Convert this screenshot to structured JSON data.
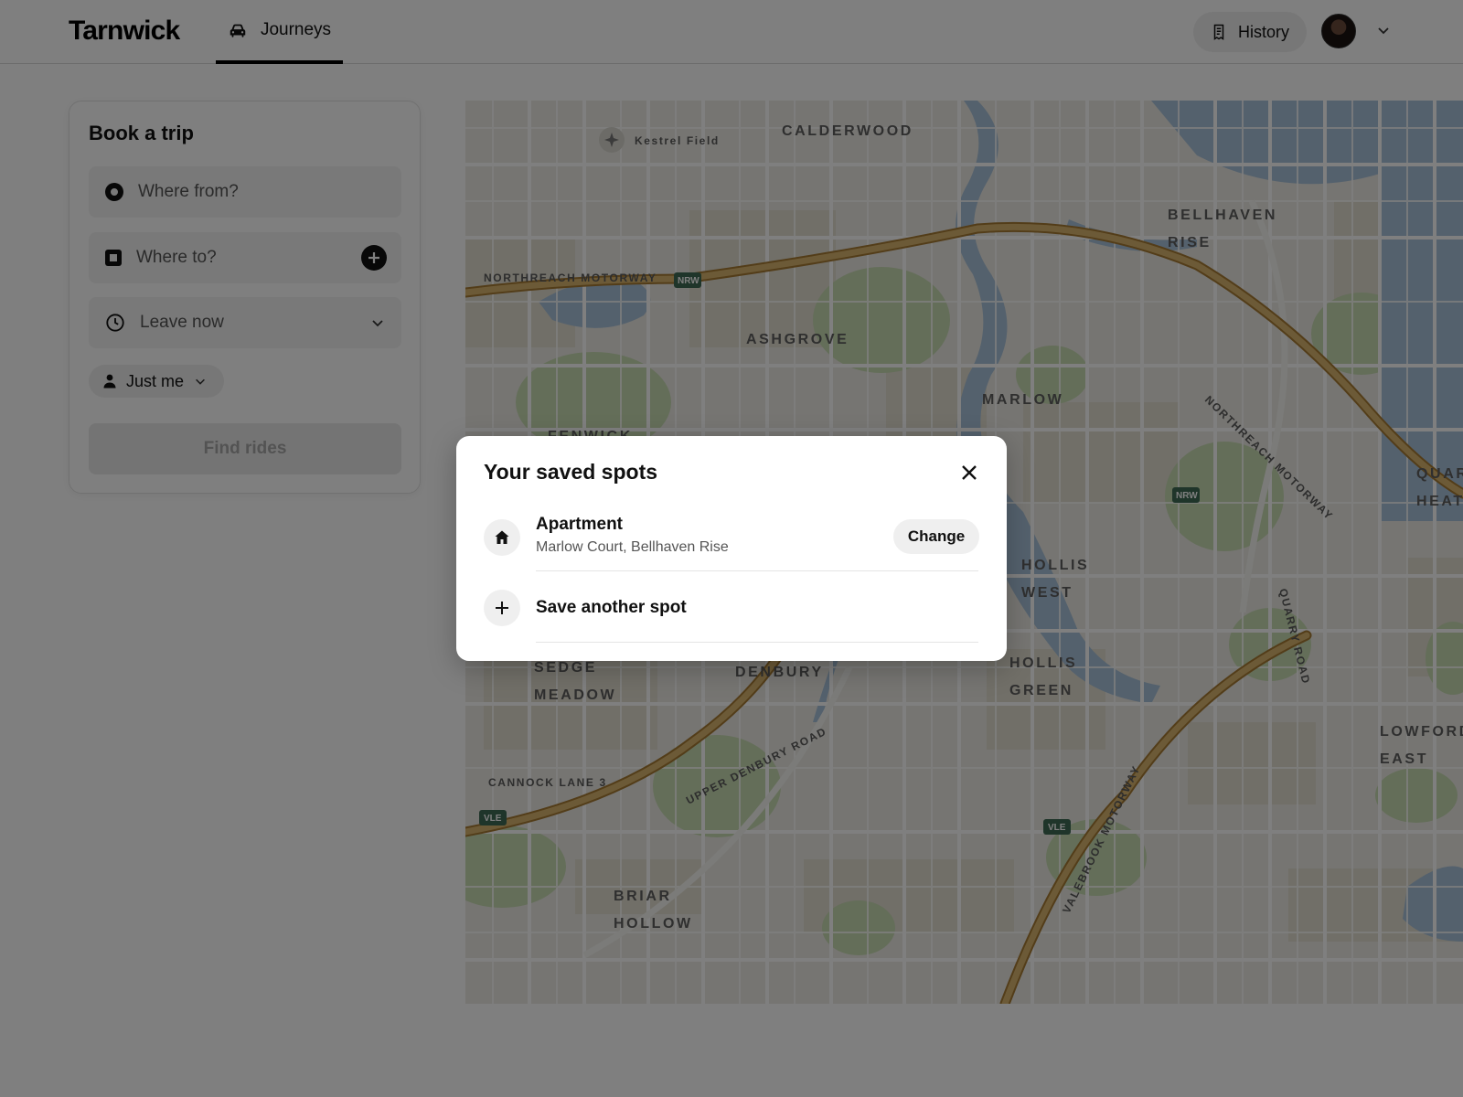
{
  "header": {
    "logo": "Tarnwick",
    "nav_tab": {
      "label": "Journeys",
      "icon": "car-icon"
    },
    "history": {
      "label": "History",
      "icon": "receipt-icon"
    },
    "avatar_menu_icon": "chevron-down-icon"
  },
  "booking": {
    "title": "Book a trip",
    "from_placeholder": "Where from?",
    "to_placeholder": "Where to?",
    "time_value": "Leave now",
    "riders_value": "Just me",
    "find_button": "Find rides"
  },
  "map": {
    "districts": [
      "CALDERWOOD",
      "BELLHAVEN",
      "RISE",
      "ASHGROVE",
      "MARLOW",
      "FENWICK",
      "QUAR",
      "HEAT",
      "HOLLIS",
      "WEST",
      "HOLLIS",
      "GREEN",
      "SEDGE",
      "MEADOW",
      "DENBURY",
      "LOWFORD",
      "EAST",
      "BRIAR",
      "HOLLOW"
    ],
    "poi": "Kestrel Field",
    "roads": [
      "NORTHREACH MOTORWAY",
      "NORTHREACH MOTORWAY",
      "QUARRY ROAD",
      "UPPER DENBURY ROAD",
      "VALEBROOK MOTORWAY",
      "CANNOCK LANE 3"
    ],
    "shields": [
      "NRW",
      "NRW",
      "VLE",
      "VLE"
    ],
    "colors": {
      "water": "#a9c2db",
      "park": "#c8dcb3",
      "block": "#e2ded0",
      "motorway": "#d9b56e",
      "shield": "#3e6b54"
    }
  },
  "modal": {
    "title": "Your saved spots",
    "spots": [
      {
        "name": "Apartment",
        "address": "Marlow Court, Bellhaven Rise",
        "icon": "home-icon",
        "action": "Change"
      }
    ],
    "add_label": "Save another spot",
    "add_icon": "plus-icon",
    "close_icon": "close-icon"
  }
}
